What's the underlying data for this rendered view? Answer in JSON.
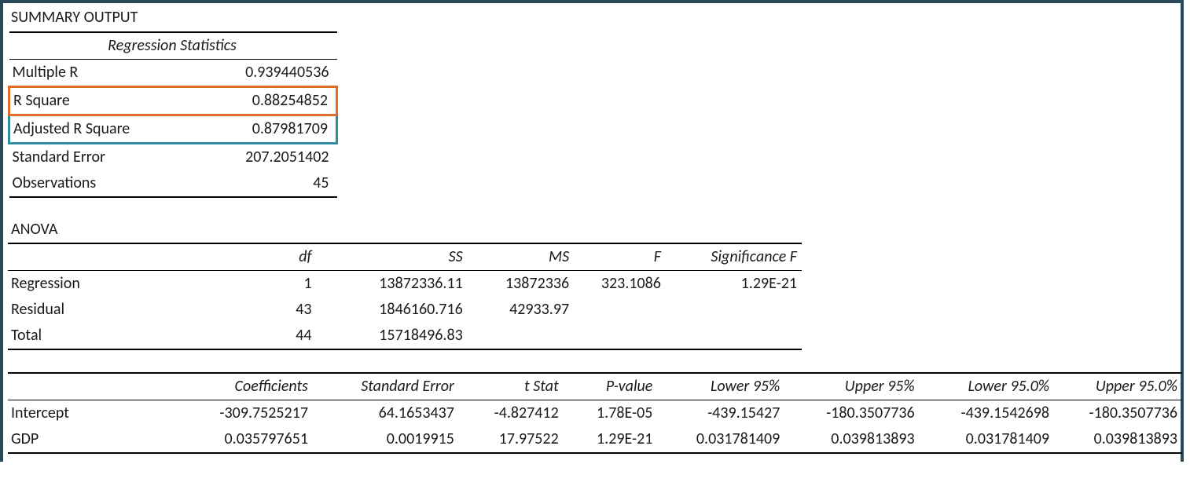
{
  "title": "SUMMARY OUTPUT",
  "stats": {
    "heading": "Regression Statistics",
    "rows": {
      "multiple_r": {
        "label": "Multiple R",
        "value": "0.939440536"
      },
      "r_square": {
        "label": "R Square",
        "value": "0.88254852"
      },
      "adj_r_square": {
        "label": "Adjusted R Square",
        "value": "0.87981709"
      },
      "std_error": {
        "label": "Standard Error",
        "value": "207.2051402"
      },
      "observations": {
        "label": "Observations",
        "value": "45"
      }
    }
  },
  "anova": {
    "heading": "ANOVA",
    "cols": {
      "df": "df",
      "ss": "SS",
      "ms": "MS",
      "f": "F",
      "sig": "Significance F"
    },
    "rows": {
      "regression": {
        "label": "Regression",
        "df": "1",
        "ss": "13872336.11",
        "ms": "13872336",
        "f": "323.1086",
        "sig": "1.29E-21"
      },
      "residual": {
        "label": "Residual",
        "df": "43",
        "ss": "1846160.716",
        "ms": "42933.97",
        "f": "",
        "sig": ""
      },
      "total": {
        "label": "Total",
        "df": "44",
        "ss": "15718496.83",
        "ms": "",
        "f": "",
        "sig": ""
      }
    }
  },
  "coef": {
    "cols": {
      "coefficients": "Coefficients",
      "stderr": "Standard Error",
      "tstat": "t Stat",
      "pvalue": "P-value",
      "l95": "Lower 95%",
      "u95": "Upper 95%",
      "l950": "Lower 95.0%",
      "u950": "Upper 95.0%"
    },
    "rows": {
      "intercept": {
        "label": "Intercept",
        "coef": "-309.7525217",
        "stderr": "64.1653437",
        "tstat": "-4.827412",
        "pvalue": "1.78E-05",
        "l95": "-439.15427",
        "u95": "-180.3507736",
        "l950": "-439.1542698",
        "u950": "-180.3507736"
      },
      "gdp": {
        "label": "GDP",
        "coef": "0.035797651",
        "stderr": "0.0019915",
        "tstat": "17.97522",
        "pvalue": "1.29E-21",
        "l95": "0.031781409",
        "u95": "0.039813893",
        "l950": "0.031781409",
        "u950": "0.039813893"
      }
    }
  }
}
